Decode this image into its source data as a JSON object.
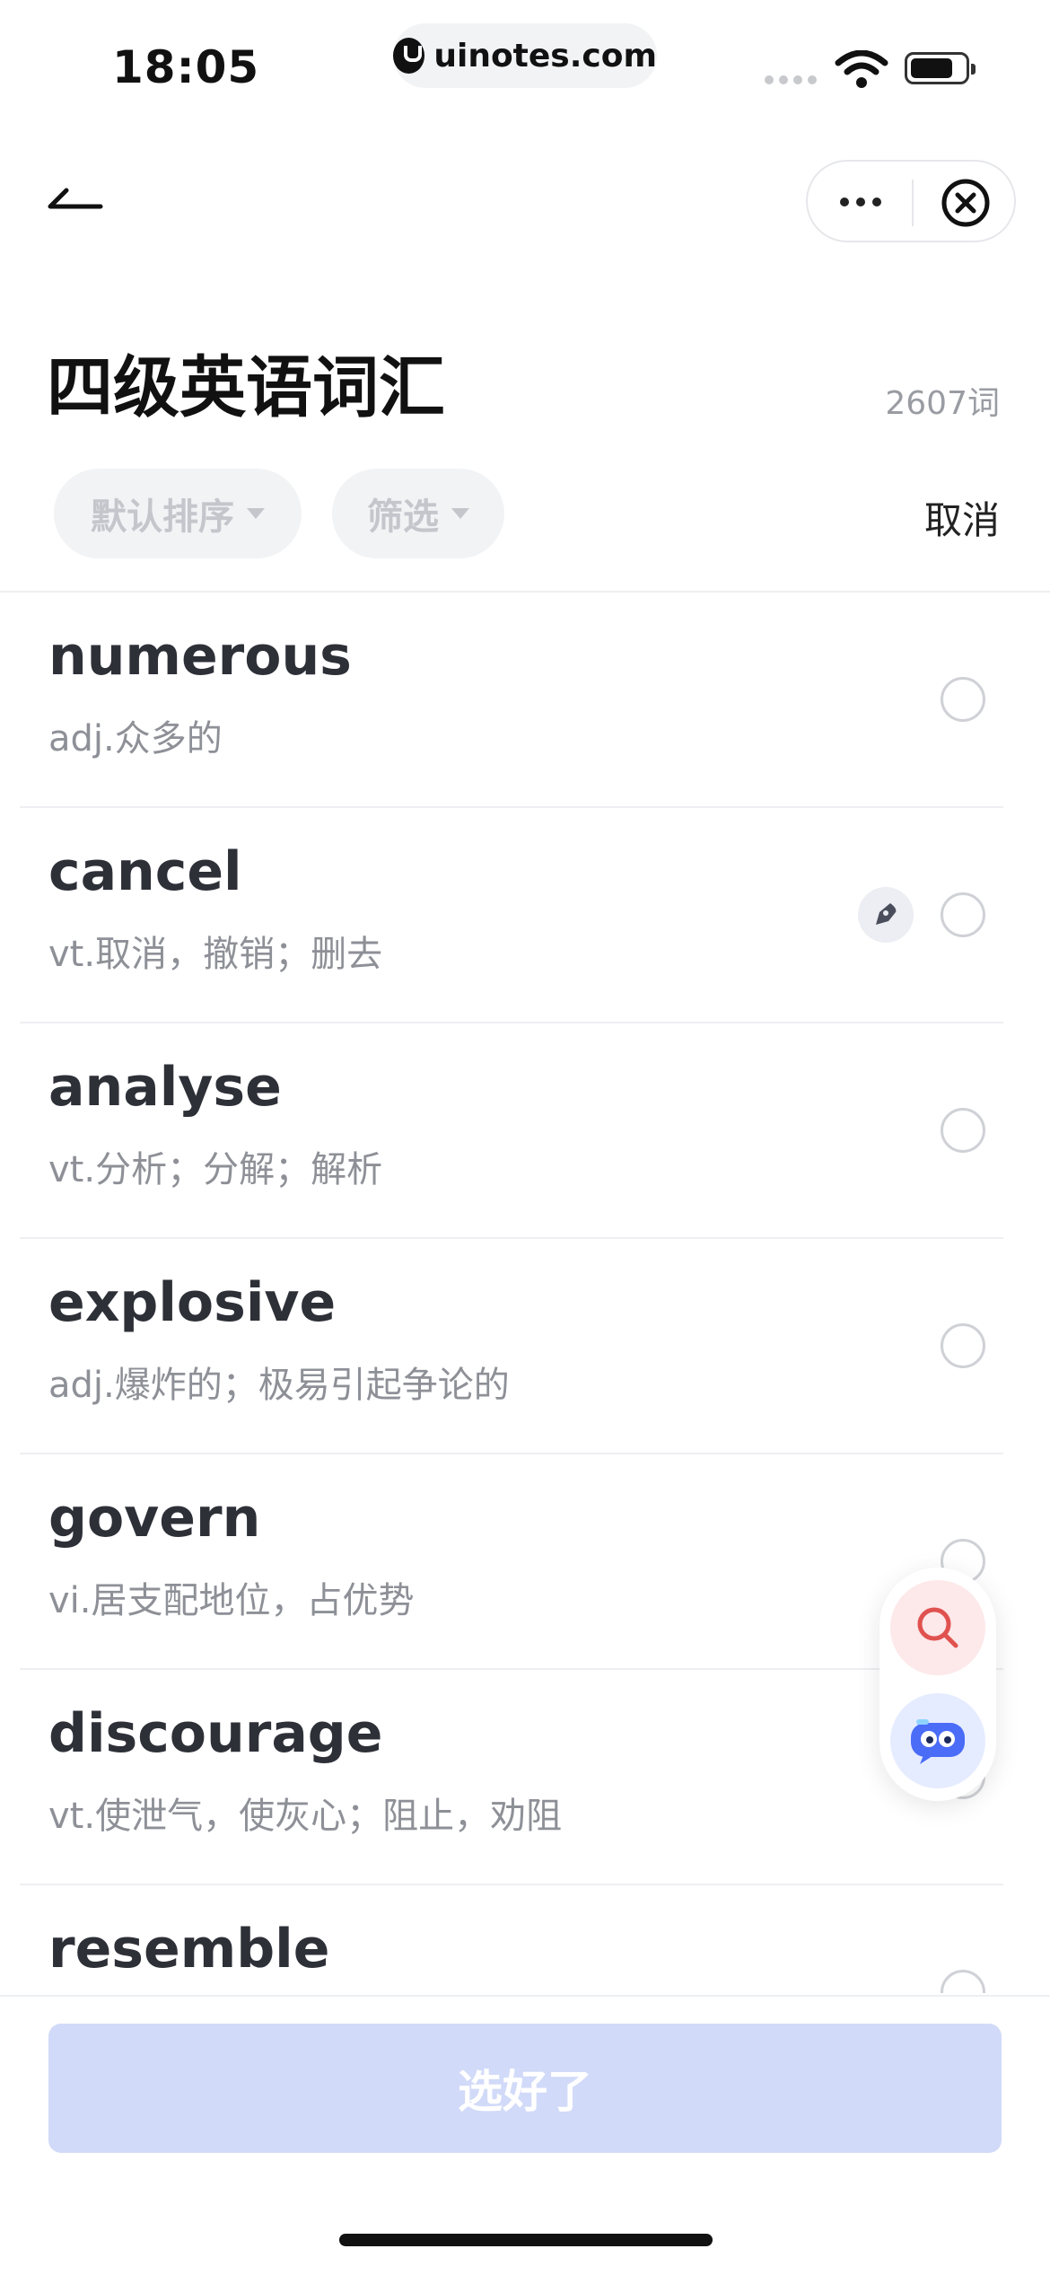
{
  "status_bar": {
    "time": "18:05",
    "url": "uinotes.com"
  },
  "header": {
    "title": "四级英语词汇",
    "word_count": "2607词",
    "sort_chip": "默认排序",
    "filter_chip": "筛选",
    "cancel": "取消"
  },
  "words": [
    {
      "word": "numerous",
      "meaning": "adj.众多的"
    },
    {
      "word": "cancel",
      "meaning": "vt.取消，撤销；删去"
    },
    {
      "word": "analyse",
      "meaning": "vt.分析；分解；解析"
    },
    {
      "word": "explosive",
      "meaning": "adj.爆炸的；极易引起争论的"
    },
    {
      "word": "govern",
      "meaning": "vi.居支配地位，占优势"
    },
    {
      "word": "discourage",
      "meaning": "vt.使泄气，使灰心；阻止，劝阻"
    },
    {
      "word": "resemble",
      "meaning": ""
    }
  ],
  "confirm_button": "选好了",
  "icons": {
    "back": "back-arrow-icon",
    "more": "more-dots-icon",
    "close": "close-circle-icon",
    "pen": "pen-icon",
    "search": "search-icon",
    "assistant": "assistant-robot-icon"
  },
  "colors": {
    "primary_disabled": "#d1daf8",
    "search_accent": "#e0524f",
    "assistant_accent": "#4a6cf7"
  }
}
